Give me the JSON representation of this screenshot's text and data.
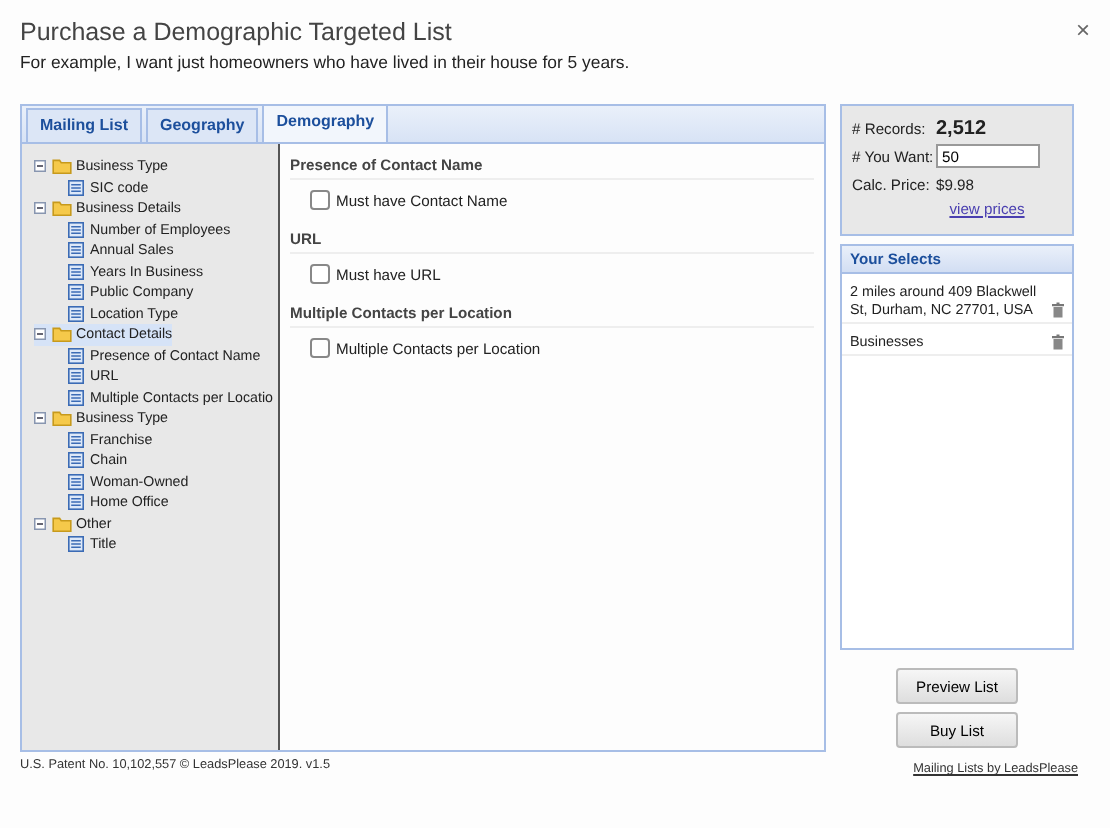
{
  "dialog": {
    "title": "Purchase a Demographic Targeted List",
    "subtitle": "For example, I want just homeowners who have lived in their house for 5 years.",
    "close": "×"
  },
  "tabs": [
    {
      "label": "Mailing List",
      "selected": false
    },
    {
      "label": "Geography",
      "selected": false
    },
    {
      "label": "Demography",
      "selected": true
    }
  ],
  "tree": [
    {
      "label": "Business Type",
      "expanded": true,
      "selected": false,
      "children": [
        {
          "label": "SIC code",
          "selected": false
        }
      ]
    },
    {
      "label": "Business Details",
      "expanded": true,
      "selected": false,
      "children": [
        {
          "label": "Number of Employees",
          "selected": false
        },
        {
          "label": "Annual Sales",
          "selected": false
        },
        {
          "label": "Years In Business",
          "selected": false
        },
        {
          "label": "Public Company",
          "selected": false
        },
        {
          "label": "Location Type",
          "selected": false
        }
      ]
    },
    {
      "label": "Contact Details",
      "expanded": true,
      "selected": true,
      "children": [
        {
          "label": "Presence of Contact Name",
          "selected": false
        },
        {
          "label": "URL",
          "selected": false
        },
        {
          "label": "Multiple Contacts per Locatio",
          "selected": false
        }
      ]
    },
    {
      "label": "Business Type",
      "expanded": true,
      "selected": false,
      "children": [
        {
          "label": "Franchise",
          "selected": false
        },
        {
          "label": "Chain",
          "selected": false
        },
        {
          "label": "Woman-Owned",
          "selected": false
        },
        {
          "label": "Home Office",
          "selected": false
        }
      ]
    },
    {
      "label": "Other",
      "expanded": true,
      "selected": false,
      "children": [
        {
          "label": "Title",
          "selected": false
        }
      ]
    }
  ],
  "sections": [
    {
      "heading": "Presence of Contact Name",
      "option": "Must have Contact Name",
      "checked": false
    },
    {
      "heading": "URL",
      "option": "Must have URL",
      "checked": false
    },
    {
      "heading": "Multiple Contacts per Location",
      "option": "Multiple Contacts per Location",
      "checked": false
    }
  ],
  "summary": {
    "records_label": "# Records:",
    "records": "2,512",
    "want_label": "# You Want:",
    "want_value": "50",
    "price_label": "Calc. Price:",
    "price": "$9.98",
    "view_prices": "view prices"
  },
  "selects": {
    "title": "Your Selects",
    "items": [
      "2 miles around 409 Blackwell St, Durham, NC 27701, USA",
      "Businesses"
    ]
  },
  "buttons": [
    "Preview List",
    "Buy List"
  ],
  "footer": {
    "patent": "U.S. Patent No. 10,102,557 © LeadsPlease 2019. v1.5",
    "link": "Mailing Lists by LeadsPlease"
  }
}
